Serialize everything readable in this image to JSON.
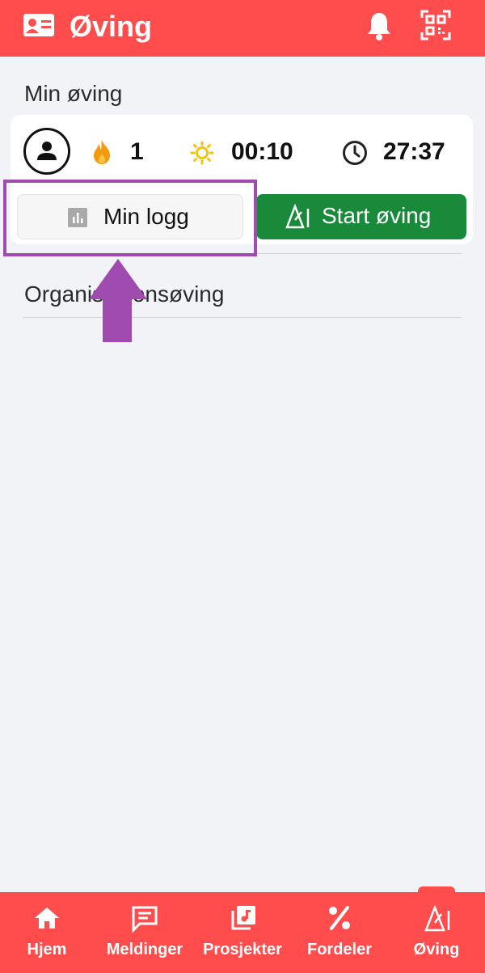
{
  "header": {
    "title": "Øving",
    "icons": [
      "id-card-icon",
      "bell-icon",
      "qr-code-icon"
    ]
  },
  "my_practice": {
    "title": "Min øving",
    "streak": "1",
    "today_time": "00:10",
    "total_time": "27:37",
    "log_button": "Min logg",
    "start_button": "Start øving"
  },
  "org_practice": {
    "title": "Organisasjonsøving"
  },
  "bottom_nav": {
    "items": [
      {
        "label": "Hjem",
        "icon": "home-icon"
      },
      {
        "label": "Meldinger",
        "icon": "chat-icon"
      },
      {
        "label": "Prosjekter",
        "icon": "music-library-icon"
      },
      {
        "label": "Fordeler",
        "icon": "percent-icon"
      },
      {
        "label": "Øving",
        "icon": "metronome-icon"
      }
    ],
    "active": "Øving"
  },
  "colors": {
    "accent": "#ff4d4d",
    "start": "#188a3a",
    "annotation": "#a04bb0"
  }
}
